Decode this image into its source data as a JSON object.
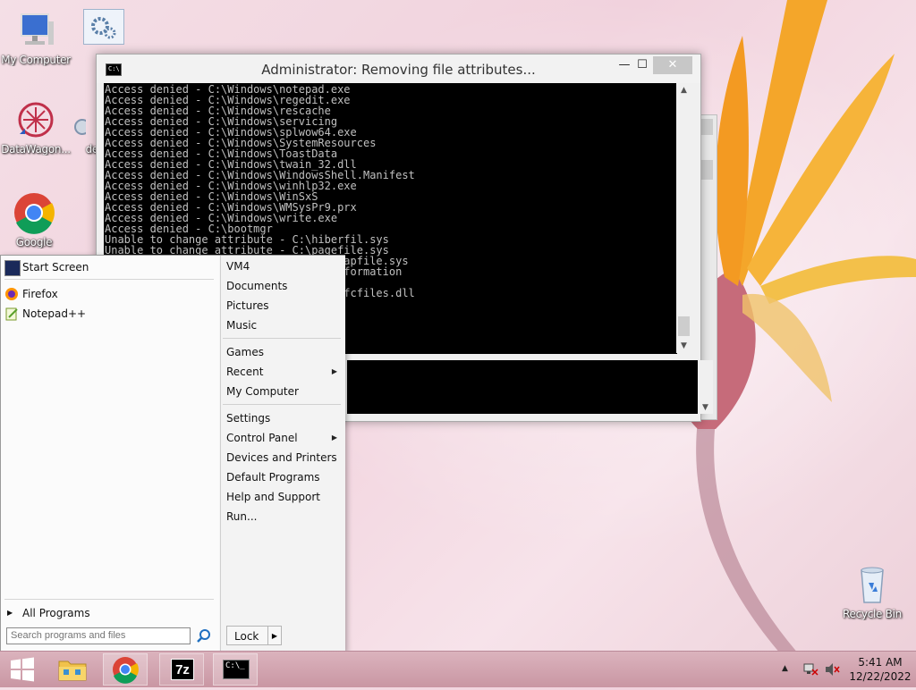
{
  "desktop": {
    "icons": [
      {
        "label": "My Computer"
      },
      {
        "label": ""
      },
      {
        "label": "DataWagon..."
      },
      {
        "label": "de"
      },
      {
        "label": "Google"
      },
      {
        "label": "Recycle Bin"
      }
    ]
  },
  "console_window": {
    "title": "Administrator:  Removing file attributes...",
    "minimize_label": "—",
    "maximize_label": "☐",
    "close_label": "✕",
    "lines": [
      "Access denied - C:\\Windows\\notepad.exe",
      "Access denied - C:\\Windows\\regedit.exe",
      "Access denied - C:\\Windows\\rescache",
      "Access denied - C:\\Windows\\servicing",
      "Access denied - C:\\Windows\\splwow64.exe",
      "Access denied - C:\\Windows\\SystemResources",
      "Access denied - C:\\Windows\\ToastData",
      "Access denied - C:\\Windows\\twain_32.dll",
      "Access denied - C:\\Windows\\WindowsShell.Manifest",
      "Access denied - C:\\Windows\\winhlp32.exe",
      "Access denied - C:\\Windows\\WinSxS",
      "Access denied - C:\\Windows\\WMSysPr9.prx",
      "Access denied - C:\\Windows\\write.exe",
      "Access denied - C:\\bootmgr",
      "Unable to change attribute - C:\\hiberfil.sys",
      "Unable to change attribute - C:\\pagefile.sys",
      "                                    wapfile.sys",
      "                                    nformation",
      "",
      "                                   \\sfcfiles.dll"
    ]
  },
  "start_menu": {
    "left_items": [
      {
        "label": "Start Screen"
      },
      {
        "label": "Firefox"
      },
      {
        "label": "Notepad++"
      }
    ],
    "all_programs": "All Programs",
    "search_placeholder": "Search programs and files",
    "right_items": [
      {
        "label": "VM4"
      },
      {
        "label": "Documents"
      },
      {
        "label": "Pictures"
      },
      {
        "label": "Music"
      },
      {
        "label": "Games"
      },
      {
        "label": "Recent"
      },
      {
        "label": "My Computer"
      },
      {
        "label": "Settings"
      },
      {
        "label": "Control Panel"
      },
      {
        "label": "Devices and Printers"
      },
      {
        "label": "Default Programs"
      },
      {
        "label": "Help and Support"
      },
      {
        "label": "Run..."
      }
    ],
    "lock_label": "Lock"
  },
  "taskbar": {
    "apps": [
      {
        "icon": "windows-start-icon"
      },
      {
        "icon": "file-explorer-icon"
      },
      {
        "icon": "chrome-icon"
      },
      {
        "icon": "7zip-icon",
        "text": "7z"
      },
      {
        "icon": "command-prompt-icon",
        "text": "C:\\_"
      }
    ],
    "clock_time": "5:41 AM",
    "clock_date": "12/22/2022"
  }
}
